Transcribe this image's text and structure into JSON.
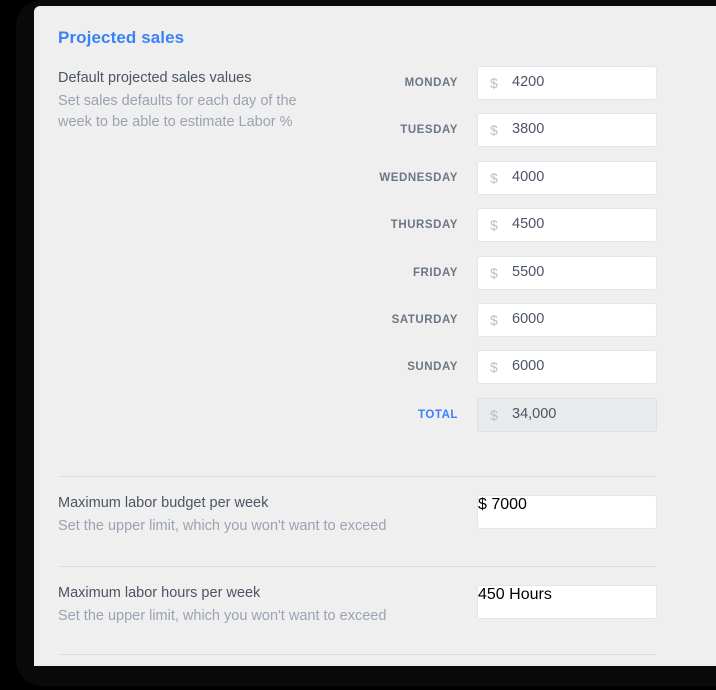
{
  "section": {
    "title": "Projected sales"
  },
  "projected": {
    "heading": "Default projected sales values",
    "subtext_line1": "Set sales defaults for each day of the",
    "subtext_line2": "week to be able to estimate Labor %",
    "currency_symbol": "$",
    "rows": [
      {
        "label": "MONDAY",
        "value": "4200",
        "readonly": false
      },
      {
        "label": "TUESDAY",
        "value": "3800",
        "readonly": false
      },
      {
        "label": "WEDNESDAY",
        "value": "4000",
        "readonly": false
      },
      {
        "label": "THURSDAY",
        "value": "4500",
        "readonly": false
      },
      {
        "label": "FRIDAY",
        "value": "5500",
        "readonly": false
      },
      {
        "label": "SATURDAY",
        "value": "6000",
        "readonly": false
      },
      {
        "label": "SUNDAY",
        "value": "6000",
        "readonly": false
      },
      {
        "label": "TOTAL",
        "value": "34,000",
        "readonly": true
      }
    ]
  },
  "limits": [
    {
      "heading": "Maximum labor budget per week",
      "subtext": "Set the upper limit, which you won't want to exceed",
      "prefix": "$",
      "value": "7000",
      "suffix": ""
    },
    {
      "heading": "Maximum labor hours per week",
      "subtext": "Set the upper limit, which you won't want to exceed",
      "prefix": "",
      "value": "450",
      "suffix": "Hours"
    }
  ],
  "colors": {
    "accent": "#3b82f6",
    "panel_bg": "#efeff0",
    "frame": "#0a0a0a",
    "label": "#6b7687",
    "text": "#4b5563",
    "muted": "#9aa3b0",
    "field_bg": "#ffffff",
    "field_readonly_bg": "#e9eaec",
    "divider": "#dcdee1"
  }
}
